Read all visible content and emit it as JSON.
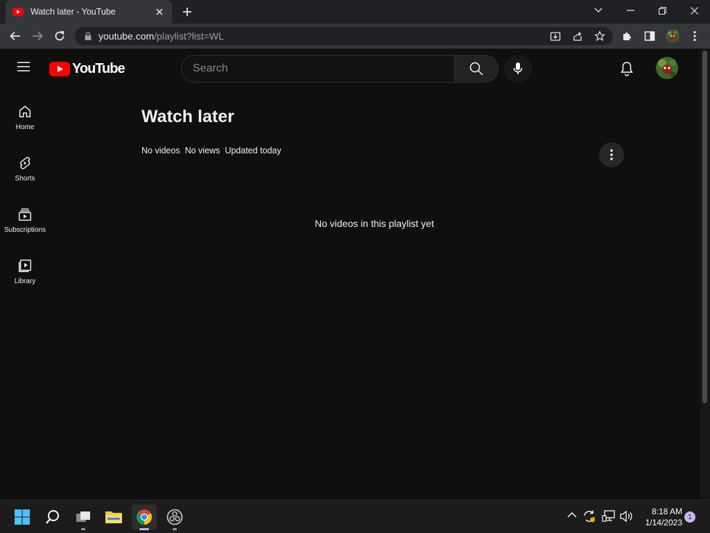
{
  "browser": {
    "tab_title": "Watch later - YouTube",
    "url_host": "youtube.com",
    "url_path": "/playlist?list=WL"
  },
  "youtube": {
    "logo_text": "YouTube",
    "search": {
      "placeholder": "Search",
      "value": ""
    },
    "guide": [
      {
        "label": "Home",
        "icon": "home-icon"
      },
      {
        "label": "Shorts",
        "icon": "shorts-icon"
      },
      {
        "label": "Subscriptions",
        "icon": "subscriptions-icon"
      },
      {
        "label": "Library",
        "icon": "library-icon"
      }
    ],
    "playlist": {
      "title": "Watch later",
      "video_count": "No videos",
      "views": "No views",
      "updated": "Updated today",
      "empty_message": "No videos in this playlist yet"
    }
  },
  "taskbar": {
    "time": "8:18 AM",
    "date": "1/14/2023",
    "notification_count": "1"
  },
  "colors": {
    "yt_red": "#ff0000",
    "background": "#0f0f0f"
  }
}
